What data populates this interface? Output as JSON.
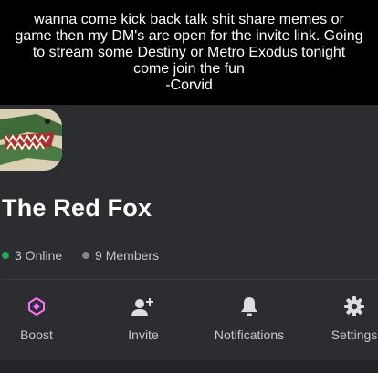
{
  "caption": {
    "text": "wanna come kick back talk shit share memes or\ngame then my DM's are open for the invite link. Going\nto stream some Destiny or Metro Exodus tonight\ncome join the fun\n-Corvid"
  },
  "server": {
    "name": "The Red Fox",
    "online": "3 Online",
    "members": "9 Members"
  },
  "actions": {
    "boost": "Boost",
    "invite": "Invite",
    "notifications": "Notifications",
    "settings": "Settings"
  },
  "colors": {
    "online_dot": "#23a55a",
    "members_dot": "#80848e",
    "boost_icon": "#ff73fa",
    "background": "#2b2d31"
  },
  "icons": [
    "server-avatar",
    "boost-icon",
    "add-user-icon",
    "bell-icon",
    "gear-icon"
  ]
}
